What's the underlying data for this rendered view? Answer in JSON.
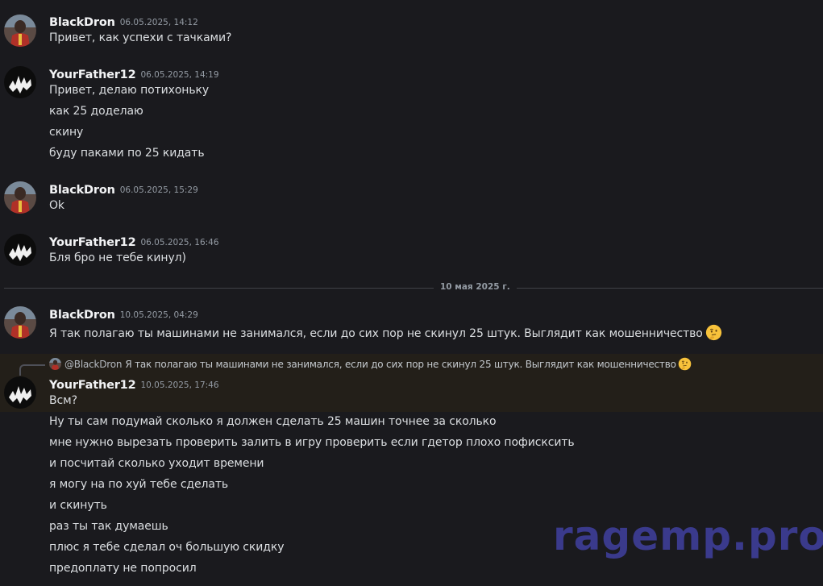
{
  "colors": {
    "background": "#1a1a1e",
    "text": "#dbdee1",
    "author": "#f2f3f5",
    "timestamp": "#949ba4",
    "highlight": "#231f19",
    "watermark": "#3a3a8c"
  },
  "messages": [
    {
      "author": "BlackDron",
      "avatar": "blackdron-avatar",
      "timestamp": "06.05.2025, 14:12",
      "lines": [
        "Привет, как успехи  с тачками?"
      ]
    },
    {
      "author": "YourFather12",
      "avatar": "yourfather-avatar",
      "timestamp": "06.05.2025, 14:19",
      "lines": [
        "Привет, делаю потихоньку",
        "как 25 доделаю",
        "скину",
        "буду паками по 25 кидать"
      ]
    },
    {
      "author": "BlackDron",
      "avatar": "blackdron-avatar",
      "timestamp": "06.05.2025, 15:29",
      "lines": [
        "Ok"
      ]
    },
    {
      "author": "YourFather12",
      "avatar": "yourfather-avatar",
      "timestamp": "06.05.2025, 16:46",
      "lines": [
        "Бля бро не тебе кинул)"
      ]
    }
  ],
  "date_divider": "10 мая 2025 г.",
  "messages_after": [
    {
      "author": "BlackDron",
      "avatar": "blackdron-avatar",
      "timestamp": "10.05.2025, 04:29",
      "lines": [
        "Я так полагаю ты машинами не занимался, если до сих пор не скинул 25 штук. Выглядит как мошенничество"
      ],
      "emoji": "thinking-face"
    },
    {
      "reply_to": {
        "author": "@BlackDron",
        "text": "Я так полагаю ты машинами не занимался, если до сих пор не скинул 25 штук. Выглядит как мошенничество",
        "emoji": "thinking-face"
      },
      "author": "YourFather12",
      "avatar": "yourfather-avatar",
      "timestamp": "10.05.2025, 17:46",
      "lines": [
        "Всм?",
        "Ну ты сам подумай сколько я должен сделать 25 машин точнее за сколько",
        "мне нужно вырезать проверить залить в игру проверить если гдетор плохо пофисксить",
        "и посчитай сколько уходит времени",
        "я могу на по хуй тебе сделать",
        "и скинуть",
        "раз ты так думаешь",
        "плюс я тебе сделал оч большую скидку",
        "предоплату не попросил"
      ]
    }
  ],
  "watermark": "ragemp.pro"
}
